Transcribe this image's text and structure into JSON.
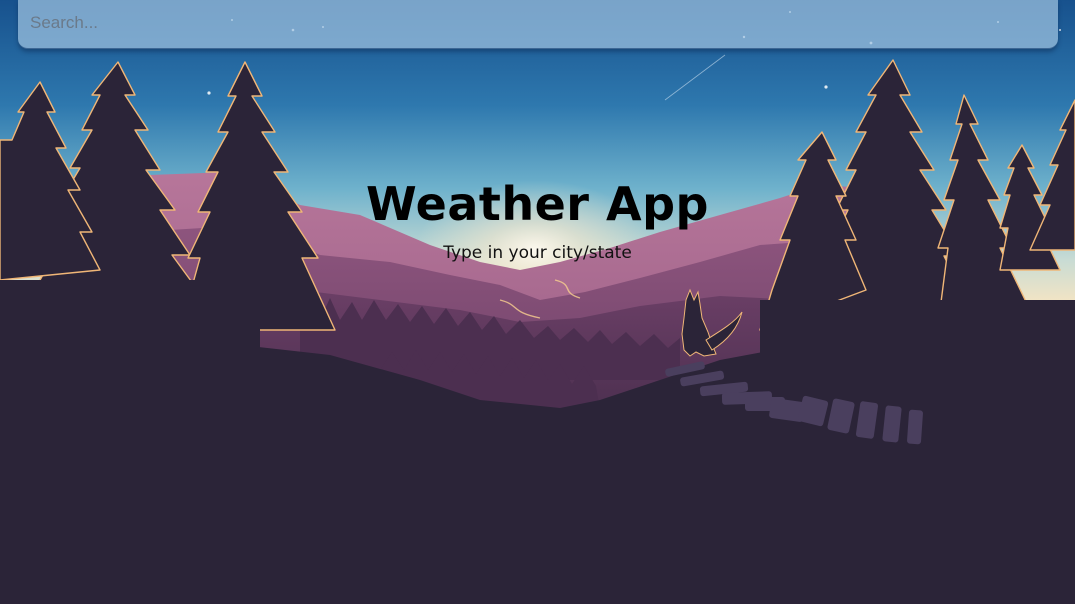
{
  "search": {
    "placeholder": "Search...",
    "value": ""
  },
  "hero": {
    "title": "Weather App",
    "subtitle": "Type in your city/state"
  },
  "background": {
    "scene": "night forest valley with fox",
    "sky_top": "#1c5d98",
    "sky_horizon": "#f4e3c0",
    "foreground": "#2b2438"
  }
}
